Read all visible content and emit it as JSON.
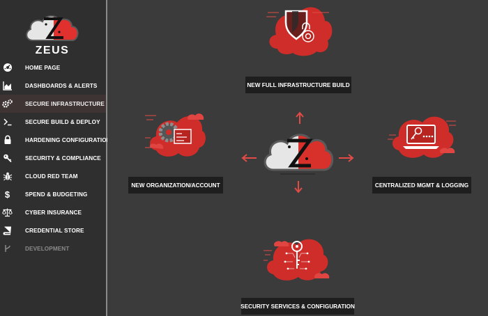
{
  "brand": {
    "name": "ZEUS",
    "accent": "#e0312f",
    "dark_red": "#b82420"
  },
  "sidebar": {
    "items": [
      {
        "label": "HOME PAGE",
        "icon": "dashboard-gauge-icon"
      },
      {
        "label": "DASHBOARDS & ALERTS",
        "icon": "area-chart-icon"
      },
      {
        "label": "SECURE INFRASTRUCTURE",
        "icon": "gears-icon",
        "active": true
      },
      {
        "label": "SECURE BUILD & DEPLOY",
        "icon": "terminal-prompt-icon"
      },
      {
        "label": "HARDENING CONFIGURATION",
        "icon": "lock-icon"
      },
      {
        "label": "SECURITY & COMPLIANCE",
        "icon": "key-icon"
      },
      {
        "label": "CLOUD RED TEAM",
        "icon": "bug-icon"
      },
      {
        "label": "SPEND & BUDGETING",
        "icon": "dollar-icon"
      },
      {
        "label": "CYBER INSURANCE",
        "icon": "balance-scale-icon"
      },
      {
        "label": "CREDENTIAL STORE",
        "icon": "book-icon"
      },
      {
        "label": "DEVELOPMENT",
        "icon": "code-branch-icon",
        "disabled": true
      }
    ]
  },
  "main": {
    "top": {
      "label": "NEW FULL INFRASTRUCTURE BUILD",
      "icon": "shield-lock-cloud-icon"
    },
    "left": {
      "label": "NEW ORGANIZATION/ACCOUNT",
      "icon": "gear-form-cloud-icon"
    },
    "right": {
      "label": "CENTRALIZED MGMT & LOGGING",
      "icon": "laptop-key-cloud-icon"
    },
    "bottom": {
      "label": "SECURITY SERVICES & CONFIGURATION",
      "icon": "key-circuit-cloud-icon"
    },
    "center": {
      "icon": "zeus-cloud-logo-icon"
    }
  }
}
